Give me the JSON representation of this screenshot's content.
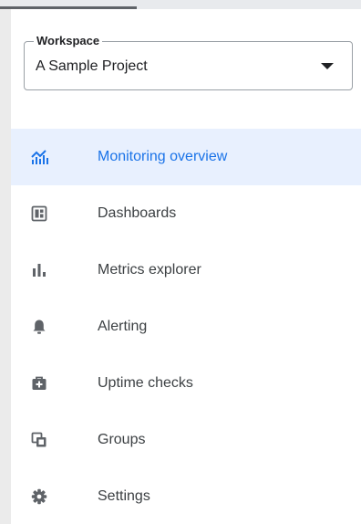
{
  "workspace": {
    "legend": "Workspace",
    "value": "A Sample Project",
    "dropdown_icon": "arrow-drop-down-icon"
  },
  "nav": {
    "items": [
      {
        "label": "Monitoring overview",
        "icon": "monitoring-chart-icon",
        "active": true
      },
      {
        "label": "Dashboards",
        "icon": "dashboard-icon",
        "active": false
      },
      {
        "label": "Metrics explorer",
        "icon": "bar-chart-icon",
        "active": false
      },
      {
        "label": "Alerting",
        "icon": "bell-icon",
        "active": false
      },
      {
        "label": "Uptime checks",
        "icon": "briefcase-plus-icon",
        "active": false
      },
      {
        "label": "Groups",
        "icon": "groups-icon",
        "active": false
      },
      {
        "label": "Settings",
        "icon": "gear-icon",
        "active": false
      }
    ]
  },
  "colors": {
    "accent": "#1a73e8",
    "active_bg": "#e8f0fe",
    "text": "#3c4043",
    "icon": "#5f6368"
  }
}
